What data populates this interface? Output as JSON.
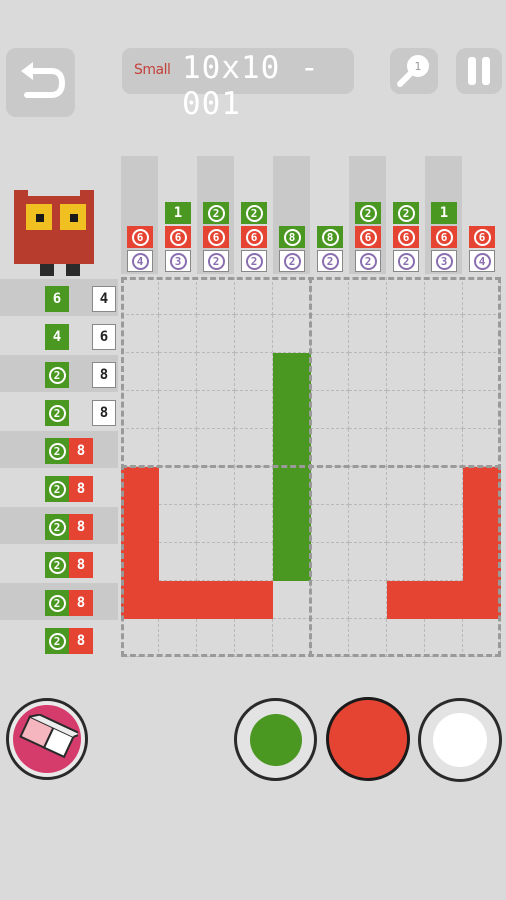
{
  "header": {
    "puzzle_size_label": "Small",
    "puzzle_name": "10x10 - 001",
    "hint_count": "1"
  },
  "colors": {
    "green": "#4a9721",
    "red": "#e64433",
    "white": "#ffffff",
    "background": "#dadada",
    "panel": "#c9c9c9"
  },
  "column_clues": [
    [
      {
        "n": "6",
        "c": "r",
        "circled": true
      },
      {
        "n": "4",
        "c": "w",
        "circled": true
      }
    ],
    [
      {
        "n": "1",
        "c": "g",
        "circled": false
      },
      {
        "n": "6",
        "c": "r",
        "circled": true
      },
      {
        "n": "3",
        "c": "w",
        "circled": true
      }
    ],
    [
      {
        "n": "2",
        "c": "g",
        "circled": true
      },
      {
        "n": "6",
        "c": "r",
        "circled": true
      },
      {
        "n": "2",
        "c": "w",
        "circled": true
      }
    ],
    [
      {
        "n": "2",
        "c": "g",
        "circled": true
      },
      {
        "n": "6",
        "c": "r",
        "circled": true
      },
      {
        "n": "2",
        "c": "w",
        "circled": true
      }
    ],
    [
      {
        "n": "8",
        "c": "g",
        "circled": true
      },
      {
        "n": "2",
        "c": "w",
        "circled": true
      }
    ],
    [
      {
        "n": "8",
        "c": "g",
        "circled": true
      },
      {
        "n": "2",
        "c": "w",
        "circled": true
      }
    ],
    [
      {
        "n": "2",
        "c": "g",
        "circled": true
      },
      {
        "n": "6",
        "c": "r",
        "circled": true
      },
      {
        "n": "2",
        "c": "w",
        "circled": true
      }
    ],
    [
      {
        "n": "2",
        "c": "g",
        "circled": true
      },
      {
        "n": "6",
        "c": "r",
        "circled": true
      },
      {
        "n": "2",
        "c": "w",
        "circled": true
      }
    ],
    [
      {
        "n": "1",
        "c": "g",
        "circled": false
      },
      {
        "n": "6",
        "c": "r",
        "circled": true
      },
      {
        "n": "3",
        "c": "w",
        "circled": true
      }
    ],
    [
      {
        "n": "6",
        "c": "r",
        "circled": true
      },
      {
        "n": "4",
        "c": "w",
        "circled": true
      }
    ]
  ],
  "row_clues": [
    [
      {
        "n": "6",
        "c": "g",
        "circled": false
      },
      {
        "n": "4",
        "c": "w",
        "circled": false
      }
    ],
    [
      {
        "n": "4",
        "c": "g",
        "circled": false
      },
      {
        "n": "6",
        "c": "w",
        "circled": false
      }
    ],
    [
      {
        "n": "2",
        "c": "g",
        "circled": true
      },
      {
        "n": "8",
        "c": "w",
        "circled": false
      }
    ],
    [
      {
        "n": "2",
        "c": "g",
        "circled": true
      },
      {
        "n": "8",
        "c": "w",
        "circled": false
      }
    ],
    [
      {
        "n": "2",
        "c": "g",
        "circled": true
      },
      {
        "n": "8",
        "c": "r",
        "circled": false
      }
    ],
    [
      {
        "n": "2",
        "c": "g",
        "circled": true
      },
      {
        "n": "8",
        "c": "r",
        "circled": false
      }
    ],
    [
      {
        "n": "2",
        "c": "g",
        "circled": true
      },
      {
        "n": "8",
        "c": "r",
        "circled": false
      }
    ],
    [
      {
        "n": "2",
        "c": "g",
        "circled": true
      },
      {
        "n": "8",
        "c": "r",
        "circled": false
      }
    ],
    [
      {
        "n": "2",
        "c": "g",
        "circled": true
      },
      {
        "n": "8",
        "c": "r",
        "circled": false
      }
    ],
    [
      {
        "n": "2",
        "c": "g",
        "circled": true
      },
      {
        "n": "8",
        "c": "r",
        "circled": false
      }
    ]
  ],
  "grid": [
    "..........",
    "..........",
    "....G.....",
    "....G.....",
    "....G.....",
    "R...G....R",
    "R...G....R",
    "R...G....R",
    "RRRR...RRR",
    ".........."
  ],
  "palette": {
    "tools": [
      "eraser-icon"
    ],
    "colors": [
      "green",
      "red",
      "white"
    ],
    "selected": "red"
  }
}
